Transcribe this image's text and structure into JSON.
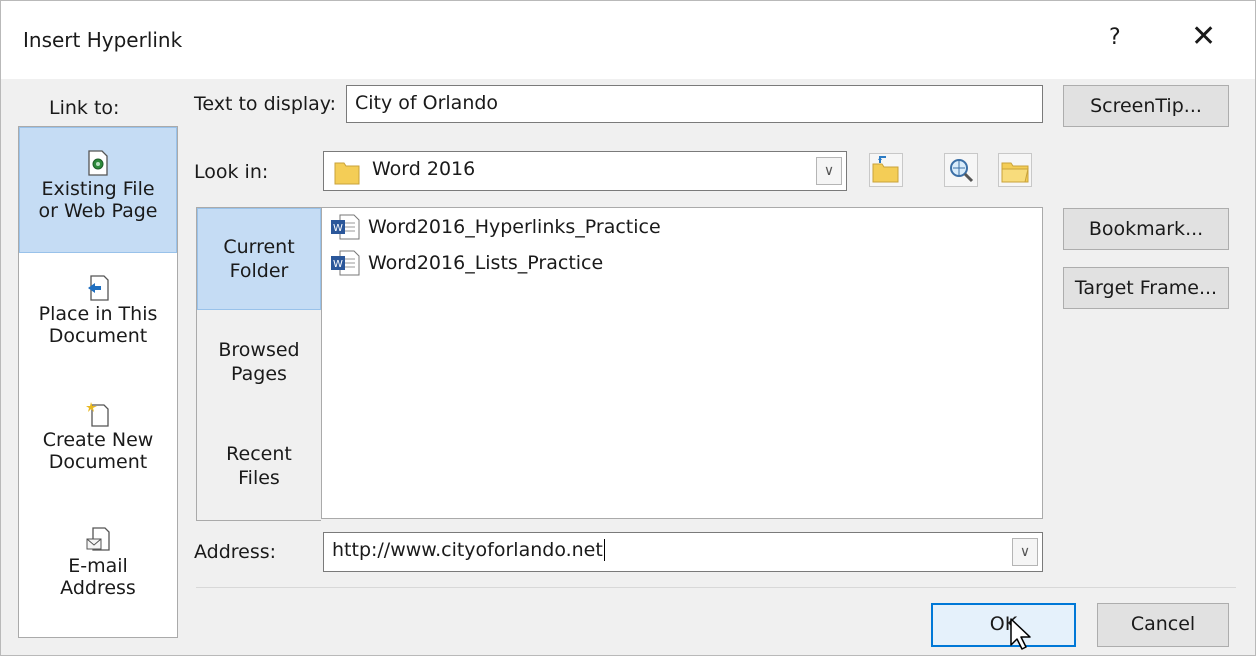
{
  "dialog": {
    "title": "Insert Hyperlink",
    "help_glyph": "?",
    "close_glyph": "✕"
  },
  "link_to": {
    "label": "Link to:",
    "items": [
      {
        "line1": "Existing File",
        "line2": "or Web Page",
        "selected": true
      },
      {
        "line1": "Place in This",
        "line2": "Document",
        "selected": false
      },
      {
        "line1": "Create New",
        "line2": "Document",
        "selected": false
      },
      {
        "line1": "E-mail",
        "line2": "Address",
        "selected": false
      }
    ]
  },
  "text_to_display": {
    "label": "Text to display:",
    "value": "City of Orlando"
  },
  "look_in": {
    "label": "Look in:",
    "value": "Word 2016"
  },
  "side_tabs": [
    {
      "line1": "Current",
      "line2": "Folder",
      "selected": true
    },
    {
      "line1": "Browsed",
      "line2": "Pages",
      "selected": false
    },
    {
      "line1": "Recent",
      "line2": "Files",
      "selected": false
    }
  ],
  "files": [
    {
      "name": "Word2016_Hyperlinks_Practice"
    },
    {
      "name": "Word2016_Lists_Practice"
    }
  ],
  "address": {
    "label": "Address:",
    "value": "http://www.cityoforlando.net"
  },
  "buttons": {
    "screentip": "ScreenTip...",
    "bookmark": "Bookmark...",
    "target_frame": "Target Frame...",
    "ok": "OK",
    "cancel": "Cancel"
  },
  "icons": {
    "combo_arrow": "chevron-down-icon",
    "folder": "folder-icon",
    "up_folder": "up-folder-icon",
    "browse_web": "browse-web-icon",
    "browse_file": "browse-file-icon",
    "word_doc": "word-document-icon"
  },
  "colors": {
    "selection": "#c5dcf4",
    "accent": "#0078d7"
  }
}
